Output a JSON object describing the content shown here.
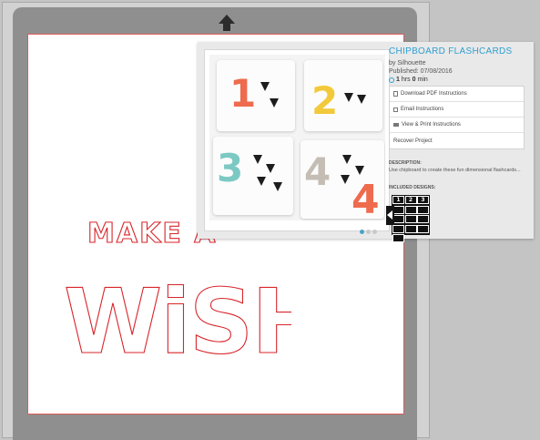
{
  "project": {
    "title": "CHIPBOARD FLASHCARDS",
    "by": "by Silhouette",
    "published": "Published: 07/08/2016",
    "time_hours": "1",
    "time_hours_unit": "hrs",
    "time_minutes": "0",
    "time_minutes_unit": "min",
    "actions": [
      {
        "label": "Download PDF Instructions",
        "icon": "pdf-icon"
      },
      {
        "label": "Email Instructions",
        "icon": "envelope-icon"
      },
      {
        "label": "View & Print Instructions",
        "icon": "printer-icon"
      },
      {
        "label": "Recover Project",
        "icon": ""
      }
    ],
    "description_label": "DESCRIPTION:",
    "description": "Use chipboard to create these fun dimensional flashcards...",
    "included_label": "INCLUDED DESIGNS:",
    "design_thumbs": [
      "1",
      "2",
      "3",
      "",
      "",
      "",
      "",
      "",
      "",
      "",
      "",
      "",
      ""
    ]
  },
  "canvas": {
    "line1": "MAKE A",
    "line2": "WiSH"
  },
  "carousel": {
    "count": 3,
    "active": 0
  },
  "colors": {
    "accent": "#2f9fd0",
    "cut_line": "#d8262b",
    "mat": "#8f8f8f"
  }
}
